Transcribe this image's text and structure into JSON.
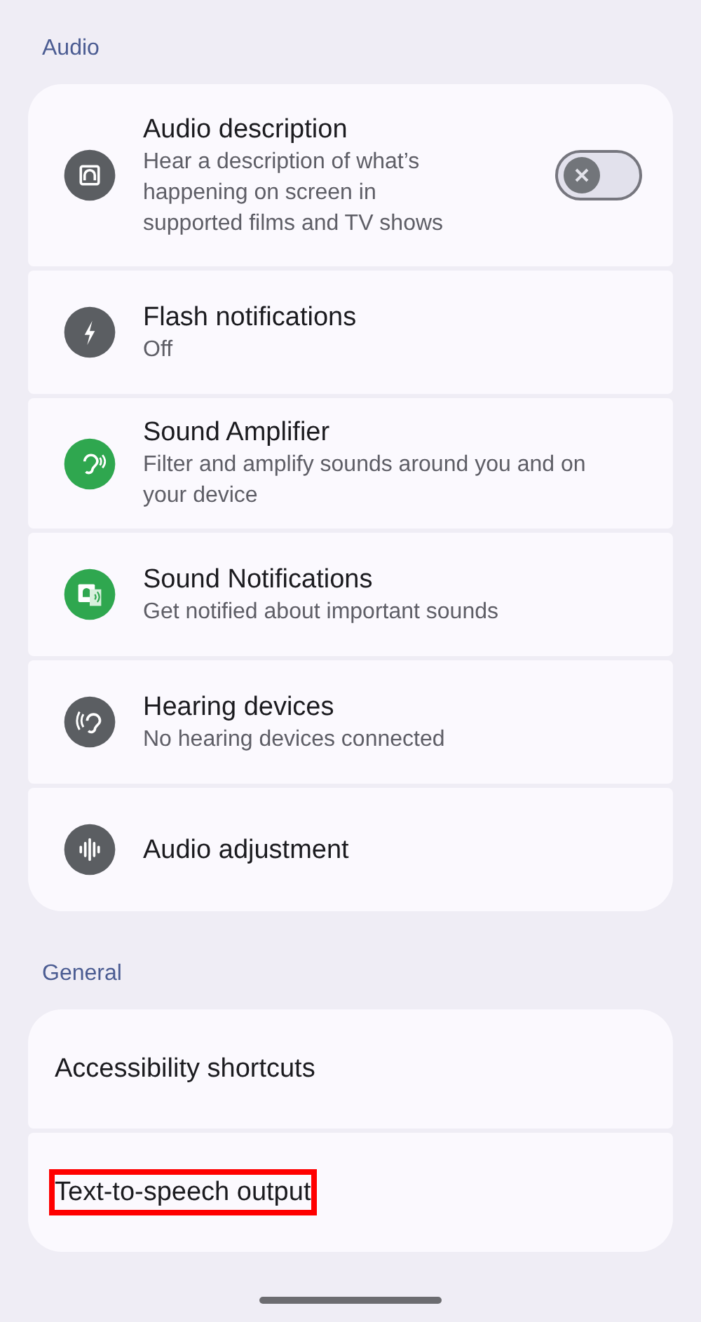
{
  "sections": [
    {
      "title": "Audio",
      "items": [
        {
          "kind": "audio-description",
          "color": "#5b5e62",
          "title": "Audio description",
          "subtitle": "Hear a description of what’s happening on screen in supported films and TV shows",
          "toggle": {
            "on": false
          }
        },
        {
          "kind": "flash",
          "color": "#5b5e62",
          "title": "Flash notifications",
          "subtitle": "Off"
        },
        {
          "kind": "ear",
          "color": "#2fa74f",
          "title": "Sound Amplifier",
          "subtitle": "Filter and amplify sounds around you and on your device"
        },
        {
          "kind": "sound-notification",
          "color": "#2fa74f",
          "title": "Sound Notifications",
          "subtitle": "Get notified about important sounds"
        },
        {
          "kind": "hearing",
          "color": "#5b5e62",
          "title": "Hearing devices",
          "subtitle": "No hearing devices connected"
        },
        {
          "kind": "waveform",
          "color": "#5b5e62",
          "title": "Audio adjustment"
        }
      ]
    },
    {
      "title": "General",
      "items": [
        {
          "title": "Accessibility shortcuts",
          "highlighted": false
        },
        {
          "title": "Text-to-speech output",
          "highlighted": true
        }
      ]
    }
  ]
}
